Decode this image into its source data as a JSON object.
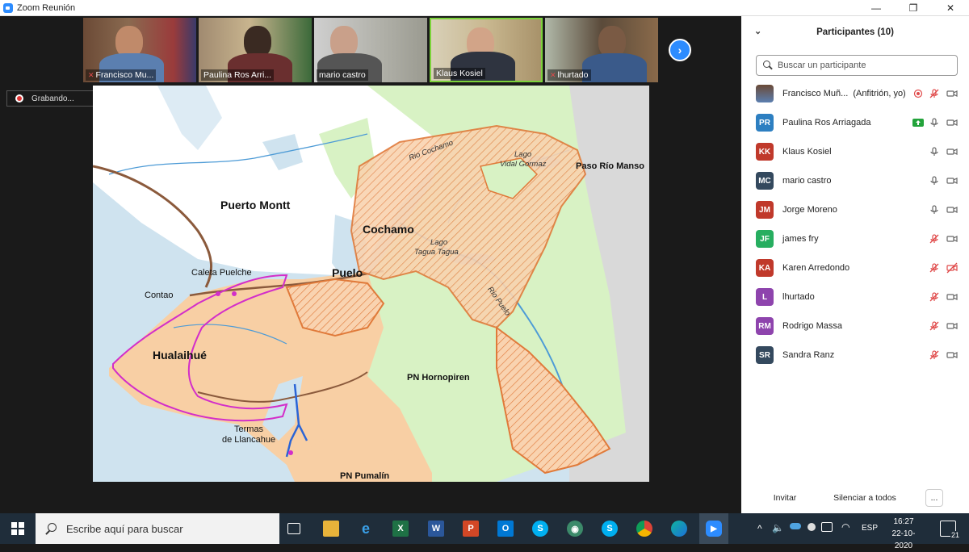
{
  "window": {
    "title": "Zoom Reunión",
    "controls": [
      "—",
      "❐",
      "✕"
    ]
  },
  "gallery": {
    "tiles": [
      {
        "name": "Francisco Mu...",
        "muted": true
      },
      {
        "name": "Paulina Ros Arri...",
        "muted": false
      },
      {
        "name": "mario castro",
        "muted": false
      },
      {
        "name": "Klaus Kosiel",
        "muted": false
      },
      {
        "name": "lhurtado",
        "muted": true
      }
    ],
    "next_icon": "chevron-right-icon"
  },
  "recording": {
    "label": "Grabando..."
  },
  "map": {
    "labels": {
      "puerto_montt": "Puerto Montt",
      "cochamo": "Cochamo",
      "puelo": "Puelo",
      "caleta_puelche": "Caleta Puelche",
      "contao": "Contao",
      "hualaihue": "Hualaihué",
      "termas_l1": "Termas",
      "termas_l2": "de Llancahue",
      "pn_hornopiren": "PN Hornopiren",
      "pn_pumalin": "PN Pumalín",
      "paso_rio_manso": "Paso Río Manso",
      "rio_cochamo": "Rio Cochamo",
      "lago_vidal_l1": "Lago",
      "lago_vidal_l2": "Vidal Gormaz",
      "lago_taguatagua_l1": "Lago",
      "lago_taguatagua_l2": "Tagua Tagua",
      "rio_puelo": "Rio Puelo"
    }
  },
  "participants_panel": {
    "title": "Participantes (10)",
    "search_placeholder": "Buscar un participante",
    "participants": [
      {
        "initials": "",
        "name": "Francisco Muñ...",
        "extra": "(Anfitrión, yo)",
        "color": "#8a5a3c",
        "mic": "muted",
        "cam": "on",
        "badge": "record"
      },
      {
        "initials": "PR",
        "name": "Paulina Ros Arriagada",
        "extra": "",
        "color": "#2d7fc1",
        "mic": "on",
        "cam": "on",
        "badge": "share"
      },
      {
        "initials": "KK",
        "name": "Klaus Kosiel",
        "extra": "",
        "color": "#c0392b",
        "mic": "on",
        "cam": "on",
        "badge": ""
      },
      {
        "initials": "MC",
        "name": "mario castro",
        "extra": "",
        "color": "#34495e",
        "mic": "on",
        "cam": "on",
        "badge": ""
      },
      {
        "initials": "JM",
        "name": "Jorge Moreno",
        "extra": "",
        "color": "#c0392b",
        "mic": "on",
        "cam": "on",
        "badge": ""
      },
      {
        "initials": "JF",
        "name": "james fry",
        "extra": "",
        "color": "#27ae60",
        "mic": "muted",
        "cam": "on",
        "badge": ""
      },
      {
        "initials": "KA",
        "name": "Karen Arredondo",
        "extra": "",
        "color": "#c0392b",
        "mic": "muted",
        "cam": "off",
        "badge": ""
      },
      {
        "initials": "L",
        "name": "lhurtado",
        "extra": "",
        "color": "#8e44ad",
        "mic": "muted",
        "cam": "on",
        "badge": ""
      },
      {
        "initials": "RM",
        "name": "Rodrigo Massa",
        "extra": "",
        "color": "#8e44ad",
        "mic": "muted",
        "cam": "on",
        "badge": ""
      },
      {
        "initials": "SR",
        "name": "Sandra Ranz",
        "extra": "",
        "color": "#34495e",
        "mic": "muted",
        "cam": "on",
        "badge": ""
      }
    ],
    "footer": {
      "invite": "Invitar",
      "mute_all": "Silenciar a todos",
      "more": "..."
    }
  },
  "taskbar": {
    "search_placeholder": "Escribe aquí para buscar",
    "language": "ESP",
    "time": "16:27",
    "date": "22-10-2020",
    "notifications": "21"
  }
}
